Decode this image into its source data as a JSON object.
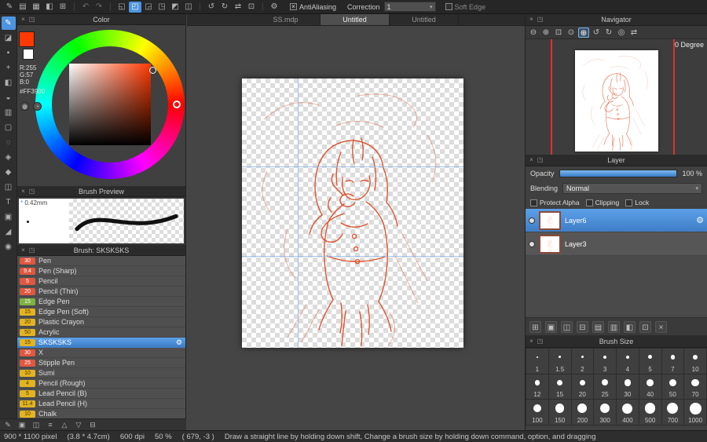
{
  "colors": {
    "accent": "#4d94e0",
    "current_hex": "#FF3900",
    "sketch": "#dd4f28"
  },
  "top_toolbar": {
    "app_icons": [
      {
        "name": "pen-settings-icon",
        "glyph": "✎"
      },
      {
        "name": "comment-icon",
        "glyph": "▤"
      },
      {
        "name": "display-icon",
        "glyph": "▦"
      },
      {
        "name": "brush-panel-icon",
        "glyph": "◧"
      },
      {
        "name": "snap-grid-icon",
        "glyph": "⊞"
      }
    ],
    "history_icons": [
      {
        "name": "undo-icon",
        "glyph": "↶"
      },
      {
        "name": "redo-icon",
        "glyph": "↷"
      }
    ],
    "select_icons": [
      {
        "name": "select-tool-icon",
        "glyph": "◱"
      },
      {
        "name": "move-selection-icon",
        "glyph": "◰",
        "selected": true
      },
      {
        "name": "select-add-icon",
        "glyph": "◲"
      },
      {
        "name": "select-subtract-icon",
        "glyph": "◳"
      },
      {
        "name": "invert-selection-icon",
        "glyph": "◩"
      },
      {
        "name": "deselect-icon",
        "glyph": "◫"
      }
    ],
    "transform_icons": [
      {
        "name": "rotate-left-canvas-icon",
        "glyph": "↺"
      },
      {
        "name": "rotate-right-canvas-icon",
        "glyph": "↻"
      },
      {
        "name": "flip-horizontal-icon",
        "glyph": "⇄"
      },
      {
        "name": "reset-view-icon",
        "glyph": "⊡"
      }
    ],
    "gear_icon": {
      "name": "gear-icon",
      "glyph": "⚙"
    },
    "antialiasing": {
      "label": "AntiAliasing",
      "checked": true
    },
    "correction": {
      "label": "Correction",
      "value": "1"
    },
    "soft_edge": {
      "label": "Soft Edge",
      "checked": false
    }
  },
  "tool_strip": [
    {
      "name": "brush-tool",
      "glyph": "✎",
      "selected": true
    },
    {
      "name": "eraser-tool",
      "glyph": "◪"
    },
    {
      "name": "dot-pen-tool",
      "glyph": "▪"
    },
    {
      "name": "move-tool",
      "glyph": "+"
    },
    {
      "name": "fill-tool",
      "glyph": "◧"
    },
    {
      "name": "bucket-tool",
      "glyph": "◒"
    },
    {
      "name": "gradient-tool",
      "glyph": "▥"
    },
    {
      "name": "select-tool",
      "glyph": "▢"
    },
    {
      "name": "lasso-tool",
      "glyph": "◌"
    },
    {
      "name": "magic-wand-tool",
      "glyph": "◈"
    },
    {
      "name": "select-pen-tool",
      "glyph": "◆"
    },
    {
      "name": "select-eraser-tool",
      "glyph": "◫"
    },
    {
      "name": "text-tool",
      "glyph": "T"
    },
    {
      "name": "operation-tool",
      "glyph": "▣"
    },
    {
      "name": "eyedropper-tool",
      "glyph": "◢"
    },
    {
      "name": "hand-tool",
      "glyph": "◉"
    }
  ],
  "tabs": [
    {
      "label": "SS.mdp",
      "active": false
    },
    {
      "label": "Untitled",
      "active": true
    },
    {
      "label": "Untitled",
      "active": false
    }
  ],
  "color_panel": {
    "title": "Color",
    "r_label": "R:255",
    "g_label": "G:57",
    "b_label": "B:0",
    "hex": "#FF3900"
  },
  "brush_preview": {
    "title": "Brush Preview",
    "marker": "*",
    "size_label": "0.42mm"
  },
  "brush_panel": {
    "title": "Brush: SKSKSKS",
    "brushes": [
      {
        "size": "30",
        "name": "Pen",
        "badge": "red"
      },
      {
        "size": "9.4",
        "name": "Pen (Sharp)",
        "badge": "red"
      },
      {
        "size": "5",
        "name": "Pencil",
        "badge": "red"
      },
      {
        "size": "20",
        "name": "Pencil (Thin)",
        "badge": "red"
      },
      {
        "size": "15",
        "name": "Edge Pen",
        "badge": "green"
      },
      {
        "size": "15",
        "name": "Edge Pen (Soft)",
        "badge": "yellow"
      },
      {
        "size": "20",
        "name": "Plastic Crayon",
        "badge": "yellow"
      },
      {
        "size": "50",
        "name": "Acrylic",
        "badge": "yellow"
      },
      {
        "size": "15",
        "name": "SKSKSKS",
        "badge": "yellow",
        "selected": true
      },
      {
        "size": "30",
        "name": "X",
        "badge": "red"
      },
      {
        "size": "25",
        "name": "Stipple Pen",
        "badge": "red"
      },
      {
        "size": "10",
        "name": "Sumi",
        "badge": "yellow"
      },
      {
        "size": "4",
        "name": "Pencil (Rough)",
        "badge": "yellow"
      },
      {
        "size": "5",
        "name": "Lead Pencil (B)",
        "badge": "yellow"
      },
      {
        "size": "11.4",
        "name": "Lead Pencil (H)",
        "badge": "yellow"
      },
      {
        "size": "10",
        "name": "Chalk",
        "badge": "yellow"
      }
    ],
    "footer_icons": [
      {
        "name": "add-brush-button",
        "glyph": "✎"
      },
      {
        "name": "add-brush-folder-button",
        "glyph": "▣"
      },
      {
        "name": "duplicate-brush-button",
        "glyph": "◫"
      },
      {
        "name": "brush-menu-button",
        "glyph": "≡"
      },
      {
        "name": "move-brush-up-button",
        "glyph": "△"
      },
      {
        "name": "move-brush-down-button",
        "glyph": "▽"
      },
      {
        "name": "delete-brush-button",
        "glyph": "⊟"
      }
    ]
  },
  "navigator": {
    "title": "Navigator",
    "degree_label": "0 Degree",
    "toolbar": [
      {
        "name": "zoom-out-icon",
        "glyph": "⊖"
      },
      {
        "name": "zoom-in-icon",
        "glyph": "⊕"
      },
      {
        "name": "fit-window-icon",
        "glyph": "⊡"
      },
      {
        "name": "actual-size-icon",
        "glyph": "⊙"
      },
      {
        "name": "zoom-select-icon",
        "glyph": "⊕",
        "selected": true
      },
      {
        "name": "rotate-left-icon",
        "glyph": "↺"
      },
      {
        "name": "rotate-right-icon",
        "glyph": "↻"
      },
      {
        "name": "reset-rotation-icon",
        "glyph": "◎"
      },
      {
        "name": "flip-view-icon",
        "glyph": "⇄"
      }
    ]
  },
  "layer_panel": {
    "title": "Layer",
    "opacity_label": "Opacity",
    "opacity_value": "100 %",
    "blending_label": "Blending",
    "blending_value": "Normal",
    "checkboxes": [
      {
        "name": "protect-alpha-checkbox",
        "label": "Protect Alpha",
        "checked": false
      },
      {
        "name": "clipping-checkbox",
        "label": "Clipping",
        "checked": false
      },
      {
        "name": "lock-checkbox",
        "label": "Lock",
        "checked": false
      }
    ],
    "layers": [
      {
        "name": "Layer6",
        "selected": true
      },
      {
        "name": "Layer3",
        "selected": false
      }
    ],
    "toolbar": [
      {
        "name": "add-layer-button",
        "glyph": "⊞"
      },
      {
        "name": "add-layer-folder-button",
        "glyph": "▣"
      },
      {
        "name": "duplicate-layer-button",
        "glyph": "◫"
      },
      {
        "name": "transfer-layer-button",
        "glyph": "⊟"
      },
      {
        "name": "merge-down-button",
        "glyph": "▤"
      },
      {
        "name": "layer-folder-button",
        "glyph": "▥"
      },
      {
        "name": "copy-layer-button",
        "glyph": "◧"
      },
      {
        "name": "flatten-button",
        "glyph": "⊡"
      },
      {
        "name": "delete-layer-button",
        "glyph": "×"
      }
    ]
  },
  "brush_size_panel": {
    "title": "Brush Size",
    "sizes": [
      "1",
      "1.5",
      "2",
      "3",
      "4",
      "5",
      "7",
      "10",
      "12",
      "15",
      "20",
      "25",
      "30",
      "40",
      "50",
      "70",
      "100",
      "150",
      "200",
      "300",
      "400",
      "500",
      "700",
      "1000"
    ]
  },
  "status_bar": {
    "dimensions": "900 * 1100 pixel",
    "physical": "(3.8 * 4.7cm)",
    "dpi": "600 dpi",
    "zoom": "50 %",
    "coordinates": "( 679, -3 )",
    "hint": "Draw a straight line by holding down shift, Change a brush size by holding down command, option, and dragging"
  },
  "panel_header_icons": {
    "close": "×",
    "popout": "◳"
  }
}
